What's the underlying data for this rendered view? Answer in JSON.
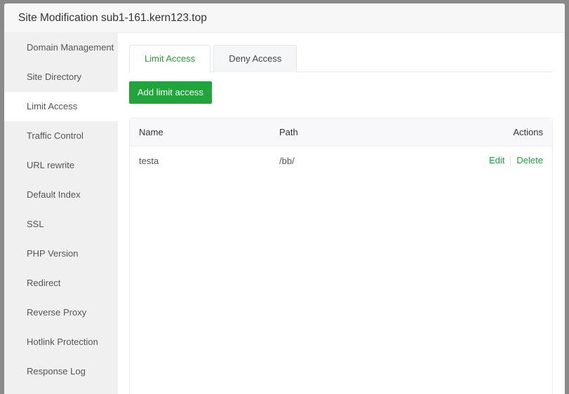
{
  "title": "Site Modification sub1-161.kern123.top",
  "sidebar": {
    "items": [
      "Domain Management",
      "Site Directory",
      "Limit Access",
      "Traffic Control",
      "URL rewrite",
      "Default Index",
      "SSL",
      "PHP Version",
      "Redirect",
      "Reverse Proxy",
      "Hotlink Protection",
      "Response Log"
    ],
    "active": "Limit Access"
  },
  "tabs": [
    {
      "label": "Limit Access",
      "active": true
    },
    {
      "label": "Deny Access",
      "active": false
    }
  ],
  "add_button": "Add limit access",
  "table": {
    "headers": [
      "Name",
      "Path",
      "Actions"
    ],
    "rows": [
      {
        "name": "testa",
        "path": "/bb/",
        "actions": [
          "Edit",
          "Delete"
        ]
      }
    ]
  },
  "colors": {
    "accent": "#20a53a"
  }
}
